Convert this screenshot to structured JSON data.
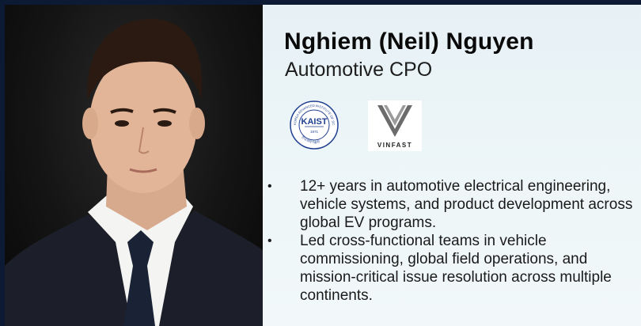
{
  "profile": {
    "name": "Nghiem (Neil) Nguyen",
    "role": "Automotive CPO"
  },
  "logos": {
    "kaist": {
      "wordmark": "KAIST",
      "ring_text": "KOREA ADVANCED INSTITUTE OF SCIENCE AND TECHNOLOGY",
      "ring_text_bottom": "한국과학기술원",
      "year": "1971"
    },
    "vinfast": {
      "wordmark": "VINFAST"
    }
  },
  "bullets": [
    "12+ years in automotive electrical engineering, vehicle systems, and product development across global EV programs.",
    "Led cross-functional teams in vehicle commissioning, global field operations, and mission-critical issue resolution across multiple continents."
  ],
  "bullet_symbol": "•",
  "colors": {
    "frame": "#0c1a33",
    "panel": "#e7f1f5",
    "kaist_blue": "#1f3f8f"
  }
}
